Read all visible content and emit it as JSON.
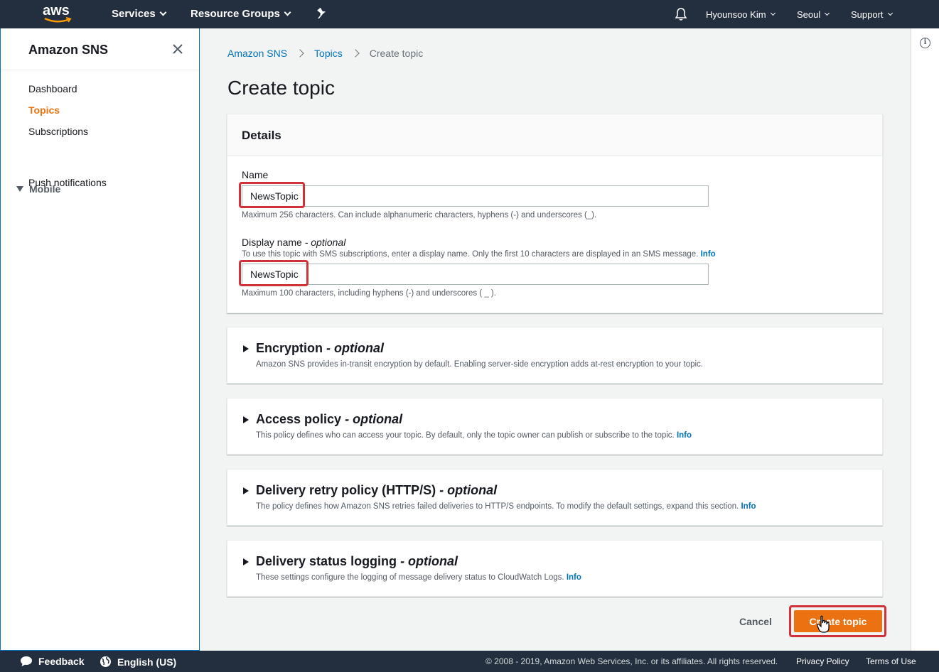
{
  "topnav": {
    "logo_text": "aws",
    "services": "Services",
    "resource_groups": "Resource Groups",
    "user": "Hyounsoo Kim",
    "region": "Seoul",
    "support": "Support"
  },
  "sidebar": {
    "title": "Amazon SNS",
    "items": [
      {
        "label": "Dashboard"
      },
      {
        "label": "Topics"
      },
      {
        "label": "Subscriptions"
      }
    ],
    "section": "Mobile",
    "section_items": [
      {
        "label": "Push notifications"
      }
    ]
  },
  "breadcrumb": {
    "root": "Amazon SNS",
    "parent": "Topics",
    "current": "Create topic"
  },
  "page_title": "Create topic",
  "details": {
    "header": "Details",
    "name_label": "Name",
    "name_value": "NewsTopic",
    "name_desc": "Maximum 256 characters. Can include alphanumeric characters, hyphens (-) and underscores (_).",
    "display_label": "Display name",
    "display_optional": "- optional",
    "display_help": "To use this topic with SMS subscriptions, enter a display name. Only the first 10 characters are displayed in an SMS message.",
    "info": "Info",
    "display_value": "NewsTopic",
    "display_desc": "Maximum 100 characters, including hyphens (-) and underscores ( _ )."
  },
  "sections": [
    {
      "title": "Encryption",
      "optional": "- optional",
      "desc": "Amazon SNS provides in-transit encryption by default. Enabling server-side encryption adds at-rest encryption to your topic.",
      "info": ""
    },
    {
      "title": "Access policy",
      "optional": "- optional",
      "desc": "This policy defines who can access your topic. By default, only the topic owner can publish or subscribe to the topic.",
      "info": "Info"
    },
    {
      "title": "Delivery retry policy (HTTP/S)",
      "optional": "- optional",
      "desc": "The policy defines how Amazon SNS retries failed deliveries to HTTP/S endpoints. To modify the default settings, expand this section.",
      "info": "Info"
    },
    {
      "title": "Delivery status logging",
      "optional": "- optional",
      "desc": "These settings configure the logging of message delivery status to CloudWatch Logs.",
      "info": "Info"
    }
  ],
  "actions": {
    "cancel": "Cancel",
    "create": "Create topic"
  },
  "footer": {
    "feedback": "Feedback",
    "language": "English (US)",
    "copyright": "© 2008 - 2019, Amazon Web Services, Inc. or its affiliates. All rights reserved.",
    "privacy": "Privacy Policy",
    "terms": "Terms of Use"
  },
  "colors": {
    "nav_bg": "#232f3e",
    "accent": "#ec7211",
    "link": "#0073bb",
    "highlight": "#d13239"
  }
}
